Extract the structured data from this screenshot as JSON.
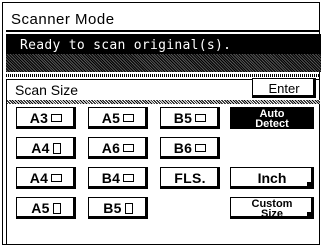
{
  "window": {
    "title": "Scanner Mode"
  },
  "status": {
    "message": "Ready to scan original(s)."
  },
  "panel": {
    "label": "Scan Size"
  },
  "actions": {
    "enter_label": "Enter"
  },
  "sizes": {
    "a3_land": "A3",
    "a5_land": "A5",
    "b5_land": "B5",
    "a4_port": "A4",
    "a6_land": "A6",
    "b6_land": "B6",
    "a4_land": "A4",
    "b4_land": "B4",
    "fls": "FLS.",
    "a5_port": "A5",
    "b5_port": "B5"
  },
  "options": {
    "auto_detect_line1": "Auto",
    "auto_detect_line2": "Detect",
    "inch": "Inch",
    "custom_line1": "Custom",
    "custom_line2": "Size"
  }
}
